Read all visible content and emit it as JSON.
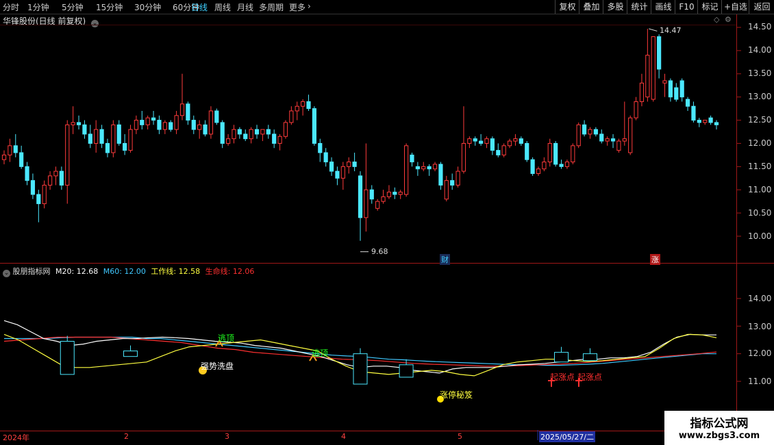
{
  "toolbar": {
    "periods": [
      "分时",
      "1分钟",
      "5分钟",
      "15分钟",
      "30分钟",
      "60分钟",
      "日线",
      "周线",
      "月线",
      "多周期",
      "更多"
    ],
    "active_period": "日线",
    "right_buttons": [
      "复权",
      "叠加",
      "多股",
      "统计",
      "画线",
      "F10",
      "标记",
      "+自选",
      "返回"
    ]
  },
  "stock_title": "华锋股份(日线 前复权)",
  "price_axis": [
    "14.50",
    "14.00",
    "13.50",
    "13.00",
    "12.50",
    "12.00",
    "11.50",
    "11.00",
    "10.50",
    "10.00"
  ],
  "indicator_axis": [
    "14.00",
    "13.00",
    "12.00",
    "11.00"
  ],
  "annotations": {
    "high": "14.47",
    "low": "9.68",
    "cai": "财",
    "zhang": "涨"
  },
  "indicator": {
    "name": "股朋指标网",
    "m20_label": "M20:",
    "m20": "12.68",
    "m60_label": "M60:",
    "m60": "12.00",
    "work_label": "工作线:",
    "work": "12.58",
    "life_label": "生命线:",
    "life": "12.06"
  },
  "signals": {
    "taoding": "逃顶",
    "qiangshi": "强势洗盘",
    "zhangting": "涨停秘笈",
    "qizhang": "起涨点"
  },
  "date_axis": {
    "year": "2024年",
    "months": [
      "2",
      "3",
      "4",
      "5"
    ],
    "cursor_date": "2025/05/27/二"
  },
  "watermark": {
    "line1": "指标公式网",
    "line2": "www.zbgs3.com"
  },
  "colors": {
    "up": "#ff3b3b",
    "down": "#4be8ff",
    "m20": "#ffffff",
    "m60": "#40c8ff",
    "work": "#ffff40",
    "life": "#ff3030",
    "signal_green": "#20ff20"
  },
  "chart_data": {
    "type": "candlestick",
    "price_range": [
      9.6,
      14.8
    ],
    "ohlc": [
      [
        11.65,
        11.85,
        11.55,
        11.75
      ],
      [
        11.75,
        12.1,
        11.6,
        11.95
      ],
      [
        11.95,
        12.2,
        11.7,
        11.8
      ],
      [
        11.8,
        11.95,
        11.45,
        11.5
      ],
      [
        11.5,
        11.6,
        11.1,
        11.2
      ],
      [
        11.2,
        11.35,
        10.8,
        10.9
      ],
      [
        10.9,
        11.0,
        10.3,
        10.7
      ],
      [
        10.7,
        11.2,
        10.6,
        11.1
      ],
      [
        11.1,
        11.4,
        11.0,
        11.3
      ],
      [
        11.3,
        11.5,
        11.1,
        11.4
      ],
      [
        11.4,
        11.5,
        11.0,
        11.1
      ],
      [
        11.1,
        12.5,
        10.7,
        12.4
      ],
      [
        12.4,
        12.8,
        12.2,
        12.45
      ],
      [
        12.45,
        12.6,
        12.3,
        12.4
      ],
      [
        12.4,
        12.5,
        12.1,
        12.2
      ],
      [
        12.2,
        12.4,
        11.9,
        12.0
      ],
      [
        12.0,
        12.5,
        11.8,
        12.3
      ],
      [
        12.3,
        12.4,
        11.9,
        12.0
      ],
      [
        12.0,
        12.1,
        11.7,
        11.8
      ],
      [
        11.8,
        12.5,
        11.7,
        12.4
      ],
      [
        12.4,
        12.5,
        11.95,
        12.0
      ],
      [
        12.0,
        12.2,
        11.75,
        11.85
      ],
      [
        11.85,
        12.4,
        11.8,
        12.3
      ],
      [
        12.3,
        12.6,
        12.2,
        12.5
      ],
      [
        12.5,
        12.7,
        12.3,
        12.4
      ],
      [
        12.4,
        12.6,
        12.3,
        12.55
      ],
      [
        12.55,
        12.7,
        12.4,
        12.5
      ],
      [
        12.5,
        12.6,
        12.2,
        12.3
      ],
      [
        12.3,
        12.5,
        12.2,
        12.45
      ],
      [
        12.45,
        12.5,
        12.25,
        12.3
      ],
      [
        12.3,
        12.7,
        12.2,
        12.6
      ],
      [
        12.6,
        13.5,
        12.5,
        12.85
      ],
      [
        12.85,
        12.9,
        12.4,
        12.5
      ],
      [
        12.5,
        12.6,
        12.2,
        12.3
      ],
      [
        12.3,
        12.5,
        12.1,
        12.4
      ],
      [
        12.4,
        12.5,
        12.15,
        12.2
      ],
      [
        12.2,
        12.8,
        12.1,
        12.7
      ],
      [
        12.7,
        12.75,
        12.4,
        12.45
      ],
      [
        12.45,
        12.5,
        11.9,
        12.0
      ],
      [
        12.0,
        12.2,
        11.95,
        12.1
      ],
      [
        12.1,
        12.4,
        12.0,
        12.3
      ],
      [
        12.3,
        12.35,
        12.1,
        12.2
      ],
      [
        12.2,
        12.3,
        12.05,
        12.1
      ],
      [
        12.1,
        12.35,
        12.0,
        12.3
      ],
      [
        12.3,
        12.4,
        12.1,
        12.2
      ],
      [
        12.2,
        12.3,
        12.05,
        12.3
      ],
      [
        12.3,
        12.4,
        12.1,
        12.2
      ],
      [
        12.2,
        12.3,
        11.9,
        12.0
      ],
      [
        12.0,
        12.2,
        11.85,
        12.15
      ],
      [
        12.15,
        12.5,
        12.1,
        12.45
      ],
      [
        12.45,
        12.8,
        12.4,
        12.7
      ],
      [
        12.7,
        12.9,
        12.5,
        12.8
      ],
      [
        12.8,
        12.95,
        12.6,
        12.9
      ],
      [
        12.9,
        13.05,
        12.7,
        12.75
      ],
      [
        12.75,
        12.8,
        11.95,
        12.0
      ],
      [
        12.0,
        12.1,
        11.6,
        11.8
      ],
      [
        11.8,
        11.9,
        11.5,
        11.6
      ],
      [
        11.6,
        11.7,
        11.3,
        11.4
      ],
      [
        11.4,
        11.5,
        11.1,
        11.25
      ],
      [
        11.25,
        11.6,
        11.0,
        11.5
      ],
      [
        11.5,
        11.7,
        11.35,
        11.6
      ],
      [
        11.6,
        11.8,
        11.4,
        11.5
      ],
      [
        11.3,
        11.4,
        9.9,
        10.4
      ],
      [
        10.4,
        12.0,
        10.1,
        11.0
      ],
      [
        11.0,
        11.1,
        10.7,
        10.8
      ],
      [
        10.6,
        10.8,
        10.55,
        10.75
      ],
      [
        10.75,
        11.0,
        10.7,
        10.85
      ],
      [
        10.85,
        11.1,
        10.8,
        10.95
      ],
      [
        10.95,
        11.05,
        10.8,
        10.9
      ],
      [
        10.9,
        11.0,
        10.8,
        10.95
      ],
      [
        10.9,
        12.0,
        10.85,
        11.95
      ],
      [
        11.75,
        11.8,
        11.5,
        11.6
      ],
      [
        11.5,
        11.6,
        11.3,
        11.45
      ],
      [
        11.45,
        11.6,
        11.4,
        11.5
      ],
      [
        11.5,
        11.55,
        11.3,
        11.45
      ],
      [
        11.45,
        11.6,
        11.4,
        11.55
      ],
      [
        11.55,
        11.6,
        11.0,
        11.1
      ],
      [
        10.8,
        11.3,
        10.75,
        11.2
      ],
      [
        11.2,
        11.35,
        11.0,
        11.1
      ],
      [
        11.1,
        11.5,
        11.05,
        11.4
      ],
      [
        11.4,
        12.8,
        11.35,
        12.0
      ],
      [
        12.0,
        12.15,
        11.9,
        12.1
      ],
      [
        12.1,
        12.15,
        11.95,
        12.05
      ],
      [
        12.05,
        12.2,
        11.95,
        12.0
      ],
      [
        12.0,
        12.15,
        11.9,
        12.1
      ],
      [
        12.1,
        12.15,
        11.75,
        11.85
      ],
      [
        11.85,
        12.0,
        11.7,
        11.75
      ],
      [
        11.75,
        12.0,
        11.7,
        11.95
      ],
      [
        11.95,
        12.1,
        11.9,
        12.05
      ],
      [
        12.05,
        12.2,
        11.95,
        12.1
      ],
      [
        12.1,
        12.15,
        11.95,
        12.0
      ],
      [
        12.0,
        12.05,
        11.6,
        11.65
      ],
      [
        11.65,
        11.7,
        11.3,
        11.35
      ],
      [
        11.35,
        11.5,
        11.3,
        11.45
      ],
      [
        11.45,
        11.7,
        11.4,
        11.6
      ],
      [
        11.6,
        12.1,
        11.5,
        12.0
      ],
      [
        12.0,
        12.05,
        11.5,
        11.55
      ],
      [
        11.55,
        11.65,
        11.45,
        11.5
      ],
      [
        11.5,
        11.65,
        11.45,
        11.6
      ],
      [
        11.6,
        12.0,
        11.55,
        11.95
      ],
      [
        11.95,
        12.45,
        11.9,
        12.4
      ],
      [
        12.4,
        12.5,
        12.15,
        12.2
      ],
      [
        12.2,
        12.35,
        12.1,
        12.3
      ],
      [
        12.3,
        12.35,
        12.15,
        12.2
      ],
      [
        12.2,
        12.3,
        12.0,
        12.05
      ],
      [
        12.05,
        12.15,
        11.95,
        12.1
      ],
      [
        12.1,
        12.2,
        11.9,
        12.05
      ],
      [
        11.85,
        12.1,
        11.8,
        12.05
      ],
      [
        12.05,
        12.9,
        11.95,
        12.1
      ],
      [
        11.8,
        12.6,
        11.75,
        12.55
      ],
      [
        12.55,
        13.0,
        12.5,
        12.9
      ],
      [
        12.9,
        13.5,
        12.8,
        13.3
      ],
      [
        13.0,
        14.47,
        12.9,
        13.9
      ],
      [
        12.95,
        14.2,
        12.9,
        14.3
      ],
      [
        14.3,
        14.35,
        13.4,
        13.6
      ],
      [
        13.3,
        13.5,
        13.0,
        13.35
      ],
      [
        13.35,
        13.4,
        12.9,
        13.0
      ],
      [
        13.2,
        13.3,
        12.9,
        12.95
      ],
      [
        13.35,
        13.4,
        12.9,
        13.0
      ],
      [
        12.95,
        13.0,
        12.7,
        12.8
      ],
      [
        12.8,
        12.9,
        12.45,
        12.5
      ],
      [
        12.5,
        12.55,
        12.35,
        12.45
      ],
      [
        12.45,
        12.5,
        12.4,
        12.5
      ],
      [
        12.55,
        12.6,
        12.4,
        12.45
      ],
      [
        12.45,
        12.5,
        12.3,
        12.4
      ]
    ],
    "ma_lines": {
      "M20": [
        13.2,
        13.05,
        12.8,
        12.55,
        12.45,
        12.3,
        12.35,
        12.45,
        12.5,
        12.55,
        12.55,
        12.58,
        12.6,
        12.58,
        12.55,
        12.5,
        12.45,
        12.42,
        12.38,
        12.3,
        12.25,
        12.2,
        12.1,
        12.0,
        11.9,
        11.75,
        11.6,
        11.5,
        11.55,
        11.55,
        11.5,
        11.4,
        11.35,
        11.3,
        11.45,
        11.5,
        11.5,
        11.5,
        11.55,
        11.6,
        11.62,
        11.65,
        11.7,
        11.75,
        11.8,
        11.8,
        11.85,
        11.85,
        11.9,
        12.05,
        12.35,
        12.6,
        12.7,
        12.68,
        12.68
      ],
      "M60": [
        12.55,
        12.55,
        12.55,
        12.55,
        12.58,
        12.6,
        12.6,
        12.6,
        12.6,
        12.6,
        12.55,
        12.55,
        12.5,
        12.45,
        12.4,
        12.35,
        12.3,
        12.25,
        12.2,
        12.15,
        12.1,
        12.05,
        12.0,
        11.95,
        11.92,
        11.9,
        11.85,
        11.8,
        11.78,
        11.75,
        11.72,
        11.7,
        11.68,
        11.66,
        11.64,
        11.62,
        11.6,
        11.6,
        11.58,
        11.58,
        11.6,
        11.62,
        11.65,
        11.7,
        11.75,
        11.8,
        11.85,
        11.9,
        11.95,
        12.0,
        12.0
      ],
      "work": [
        12.7,
        12.5,
        12.2,
        11.9,
        11.6,
        11.5,
        11.5,
        11.55,
        11.6,
        11.65,
        11.7,
        11.9,
        12.1,
        12.25,
        12.3,
        12.35,
        12.4,
        12.45,
        12.5,
        12.4,
        12.3,
        12.2,
        12.1,
        11.8,
        11.55,
        11.35,
        11.3,
        11.25,
        11.3,
        11.35,
        11.4,
        11.35,
        11.25,
        11.2,
        11.4,
        11.6,
        11.7,
        11.75,
        11.8,
        11.8,
        11.75,
        11.72,
        11.75,
        11.8,
        11.85,
        11.9,
        12.2,
        12.55,
        12.7,
        12.68,
        12.58
      ],
      "life": [
        12.45,
        12.5,
        12.55,
        12.6,
        12.6,
        12.6,
        12.6,
        12.55,
        12.5,
        12.45,
        12.4,
        12.3,
        12.2,
        12.15,
        12.05,
        12.0,
        11.95,
        11.9,
        11.85,
        11.8,
        11.78,
        11.75,
        11.7,
        11.65,
        11.62,
        11.6,
        11.58,
        11.55,
        11.55,
        11.57,
        11.6,
        11.62,
        11.65,
        11.7,
        11.75,
        11.8,
        11.85,
        11.9,
        11.95,
        12.0,
        12.06
      ]
    },
    "bottom_boxes": [
      {
        "candle": 11,
        "low": 11.25,
        "high": 12.45,
        "up": false
      },
      {
        "candle": 22,
        "low": 11.9,
        "high": 12.1,
        "up": false
      },
      {
        "candle": 62,
        "low": 10.9,
        "high": 12.0,
        "up": false
      },
      {
        "candle": 70,
        "low": 11.15,
        "high": 11.6,
        "up": false
      },
      {
        "candle": 97,
        "low": 11.7,
        "high": 12.05,
        "up": true
      },
      {
        "candle": 102,
        "low": 11.75,
        "high": 12.0,
        "up": false
      }
    ]
  }
}
